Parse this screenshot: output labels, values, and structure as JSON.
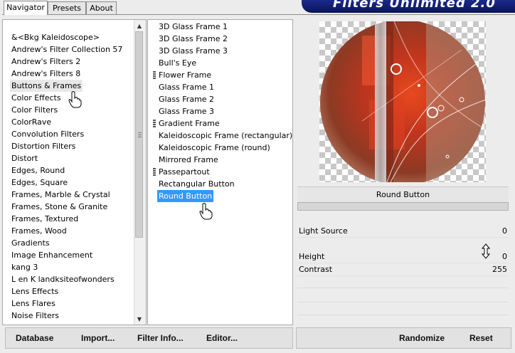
{
  "app": {
    "banner_title": "Filters Unlimited 2.0"
  },
  "tabs": [
    {
      "label": "Navigator",
      "active": true
    },
    {
      "label": "Presets",
      "active": false
    },
    {
      "label": "About",
      "active": false
    }
  ],
  "categories": [
    "&<Bkg Kaleidoscope>",
    "Andrew's Filter Collection 57",
    "Andrew's Filters 2",
    "Andrew's Filters 8",
    "Buttons & Frames",
    "Color Effects",
    "Color Filters",
    "ColorRave",
    "Convolution Filters",
    "Distortion Filters",
    "Distort",
    "Edges, Round",
    "Edges, Square",
    "Frames, Marble & Crystal",
    "Frames, Stone & Granite",
    "Frames, Textured",
    "Frames, Wood",
    "Gradients",
    "Image Enhancement",
    "kang 3",
    "L en K landksiteofwonders",
    "Lens Effects",
    "Lens Flares",
    "Noise Filters"
  ],
  "selected_category": "Buttons & Frames",
  "filters": [
    {
      "label": "3D Glass Frame 1",
      "has_marker": false
    },
    {
      "label": "3D Glass Frame 2",
      "has_marker": false
    },
    {
      "label": "3D Glass Frame 3",
      "has_marker": false
    },
    {
      "label": "Bull's Eye",
      "has_marker": false
    },
    {
      "label": "Flower Frame",
      "has_marker": true
    },
    {
      "label": "Glass Frame 1",
      "has_marker": false
    },
    {
      "label": "Glass Frame 2",
      "has_marker": false
    },
    {
      "label": "Glass Frame 3",
      "has_marker": false
    },
    {
      "label": "Gradient Frame",
      "has_marker": true
    },
    {
      "label": "Kaleidoscopic Frame (rectangular)",
      "has_marker": false
    },
    {
      "label": "Kaleidoscopic Frame (round)",
      "has_marker": false
    },
    {
      "label": "Mirrored Frame",
      "has_marker": false
    },
    {
      "label": "Passepartout",
      "has_marker": true
    },
    {
      "label": "Rectangular Button",
      "has_marker": false
    },
    {
      "label": "Round Button",
      "has_marker": false
    }
  ],
  "selected_filter": "Round Button",
  "preview": {
    "filter_title": "Round Button"
  },
  "parameters": [
    {
      "label": "Light Source",
      "value": "0"
    },
    {
      "label": "Height",
      "value": "0"
    },
    {
      "label": "Contrast",
      "value": "255"
    }
  ],
  "bottom_left_buttons": {
    "database": "Database",
    "import": "Import...",
    "filter_info": "Filter Info...",
    "editor": "Editor..."
  },
  "bottom_right_buttons": {
    "randomize": "Randomize",
    "reset": "Reset"
  },
  "colors": {
    "selection_blue": "#3399ff",
    "banner_blue": "#1b2a8c"
  }
}
